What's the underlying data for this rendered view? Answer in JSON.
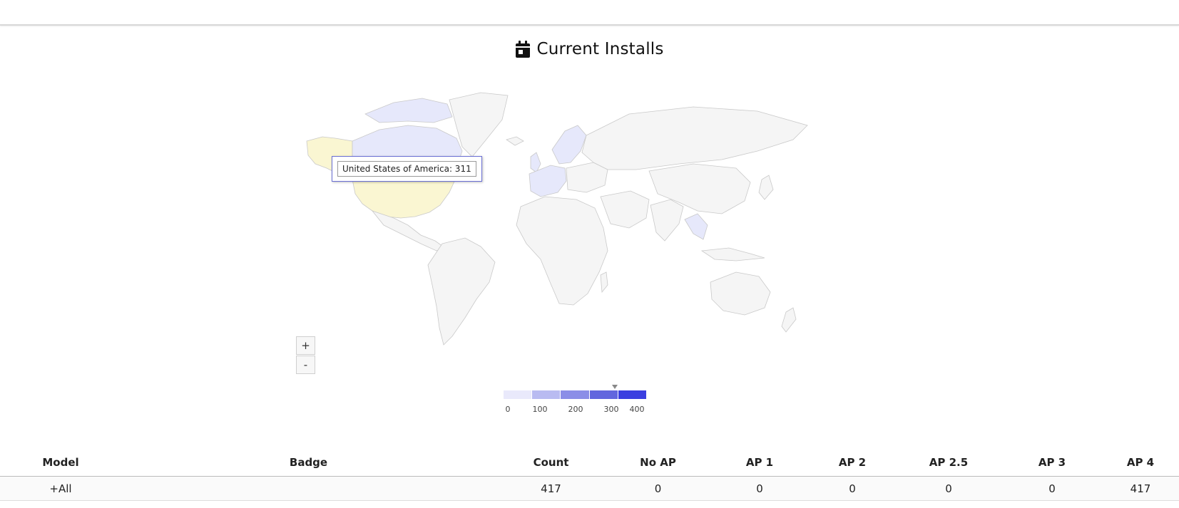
{
  "page": {
    "title": "Current Installs",
    "title_icon": "calendar-icon"
  },
  "map": {
    "tooltip": "United States of America: 311",
    "highlight_color": "#faf6d2",
    "scale_low_color": "#eeeeff",
    "scale_high_color": "#3b3fe0",
    "default_country_color": "#f5f5f5",
    "zoom_in_label": "+",
    "zoom_out_label": "-",
    "legend": {
      "ticks": [
        "0",
        "100",
        "200",
        "300",
        "400"
      ],
      "marker_value": 311,
      "colors": [
        "#e9e9fb",
        "#b9bbf1",
        "#8b8ee7",
        "#6266de",
        "#3b3fe0"
      ]
    }
  },
  "table": {
    "headers": [
      "Model",
      "Badge",
      "Count",
      "No AP",
      "AP 1",
      "AP 2",
      "AP 2.5",
      "AP 3",
      "AP 4"
    ],
    "rows": [
      {
        "model": "+All",
        "badge": "",
        "count": "417",
        "no_ap": "0",
        "ap1": "0",
        "ap2": "0",
        "ap25": "0",
        "ap3": "0",
        "ap4": "417"
      }
    ]
  }
}
